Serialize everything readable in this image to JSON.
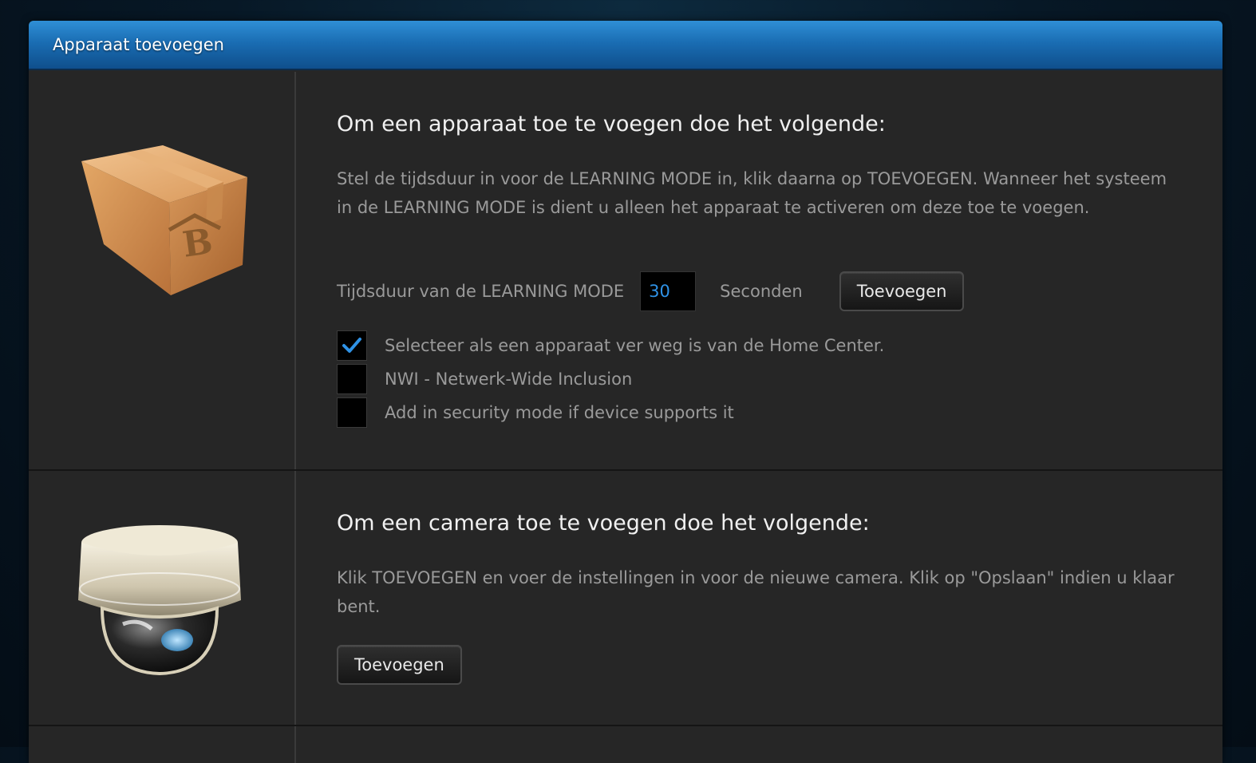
{
  "header": {
    "title": "Apparaat toevoegen"
  },
  "device_section": {
    "icon": "box-icon",
    "title": "Om een apparaat toe te voegen doe het volgende:",
    "description": "Stel de tijdsduur in voor de LEARNING MODE in, klik daarna op TOEVOEGEN. Wanneer het systeem in de LEARNING MODE is dient u alleen het apparaat te activeren om deze toe te voegen.",
    "duration_label": "Tijdsduur van de LEARNING MODE",
    "duration_value": "30",
    "duration_unit": "Seconden",
    "add_button": "Toevoegen",
    "options": [
      {
        "label": "Selecteer als een apparaat ver weg is van de Home Center.",
        "checked": true
      },
      {
        "label": "NWI - Netwerk-Wide Inclusion",
        "checked": false
      },
      {
        "label": "Add in security mode if device supports it",
        "checked": false
      }
    ]
  },
  "camera_section": {
    "icon": "dome-camera-icon",
    "title": "Om een camera toe te voegen doe het volgende:",
    "description": "Klik TOEVOEGEN en voer de instellingen in voor de nieuwe camera. Klik op \"Opslaan\" indien u klaar bent.",
    "add_button": "Toevoegen"
  },
  "colors": {
    "header_blue": "#1a6db3",
    "panel_bg": "#262626",
    "input_text": "#2f92e6",
    "check_color": "#2f92e6"
  }
}
